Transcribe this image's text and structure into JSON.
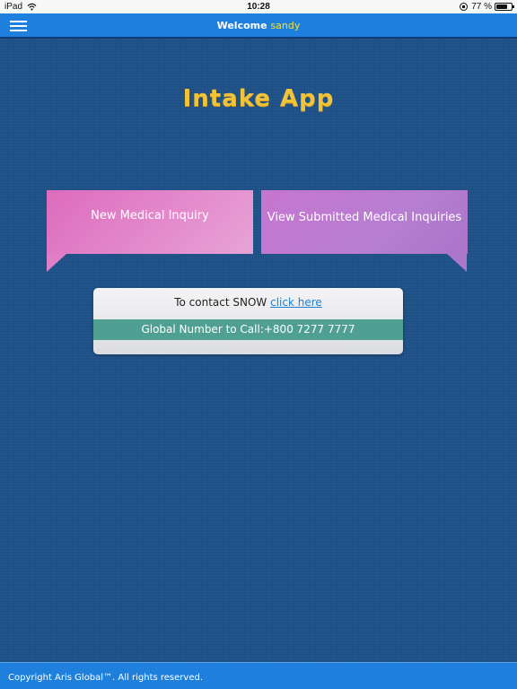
{
  "status_bar": {
    "device": "iPad",
    "time": "10:28",
    "battery": "77 %",
    "battery_level": 0.77
  },
  "header": {
    "welcome_label": "Welcome",
    "username": "sandy",
    "menu_icon": "hamburger-menu-icon"
  },
  "main": {
    "app_title": "Intake App",
    "tiles": [
      {
        "label": "New Medical Inquiry"
      },
      {
        "label": "View Submitted Medical Inquiries"
      }
    ],
    "contact": {
      "prefix": "To contact SNOW",
      "link_label": "click here",
      "global_number": "Global Number to Call:+800 7277 7777"
    }
  },
  "footer": {
    "copyright": "Copyright Aris Global™. All rights reserved."
  },
  "colors": {
    "nav_bg": "#1e80dc",
    "content_bg": "#1c4f86",
    "title": "#f2c336",
    "username": "#f3e23c",
    "tile_new": "#e08ccd",
    "tile_view": "#b77ed1",
    "global_number_bg": "#4fa093",
    "link": "#1e7fd0"
  }
}
